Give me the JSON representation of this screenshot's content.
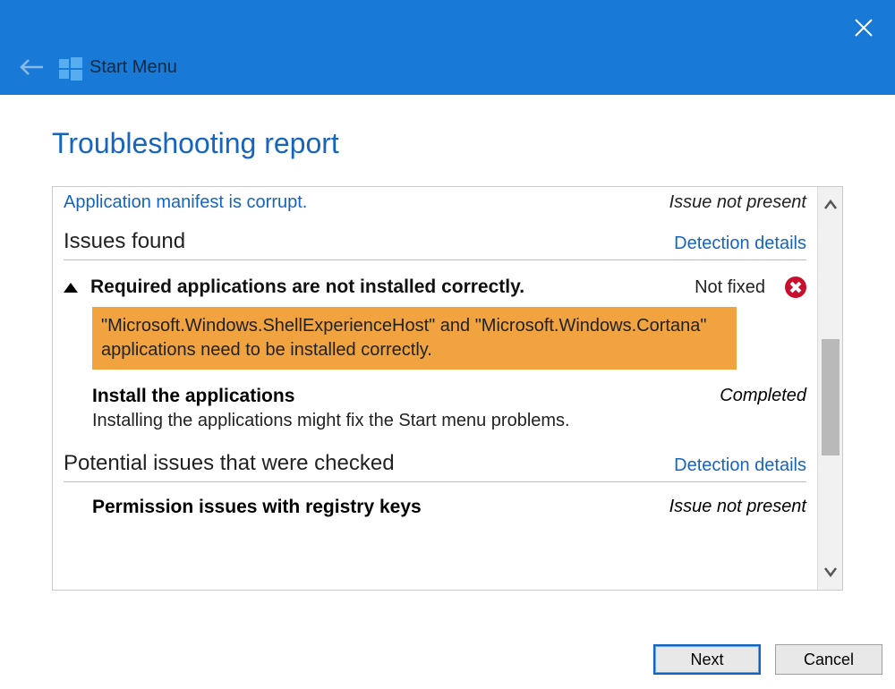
{
  "header": {
    "app_title": "Start Menu"
  },
  "page": {
    "title": "Troubleshooting report"
  },
  "top_issue": {
    "label": "Application manifest is corrupt.",
    "status": "Issue not present"
  },
  "issues_found": {
    "heading": "Issues found",
    "details_link": "Detection details",
    "item": {
      "title": "Required applications are not installed correctly.",
      "status": "Not fixed",
      "highlight": "\"Microsoft.Windows.ShellExperienceHost\" and \"Microsoft.Windows.Cortana\" applications need to be installed correctly."
    },
    "fix": {
      "title": "Install the applications",
      "status": "Completed",
      "desc": "Installing the applications might fix the Start menu problems."
    }
  },
  "potential": {
    "heading": "Potential issues that were checked",
    "details_link": "Detection details",
    "item": {
      "title": "Permission issues with registry keys",
      "status": "Issue not present"
    }
  },
  "buttons": {
    "next": "Next",
    "cancel": "Cancel"
  }
}
